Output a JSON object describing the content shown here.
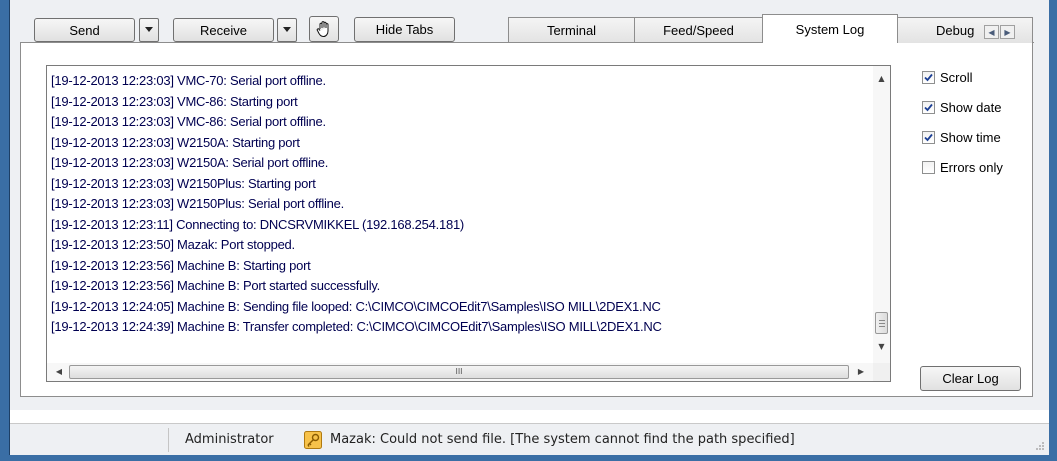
{
  "toolbar": {
    "send_label": "Send",
    "receive_label": "Receive",
    "hide_tabs_label": "Hide Tabs"
  },
  "tabs": [
    {
      "label": "Terminal",
      "active": false
    },
    {
      "label": "Feed/Speed",
      "active": false
    },
    {
      "label": "System Log",
      "active": true
    },
    {
      "label": "Debug",
      "active": false
    }
  ],
  "log": {
    "lines": [
      "[19-12-2013 12:23:03] VMC-70: Serial port offline.",
      "[19-12-2013 12:23:03] VMC-86: Starting port",
      "[19-12-2013 12:23:03] VMC-86: Serial port offline.",
      "[19-12-2013 12:23:03] W2150A: Starting port",
      "[19-12-2013 12:23:03] W2150A: Serial port offline.",
      "[19-12-2013 12:23:03] W2150Plus: Starting port",
      "[19-12-2013 12:23:03] W2150Plus: Serial port offline.",
      "[19-12-2013 12:23:11] Connecting to: DNCSRVMIKKEL (192.168.254.181)",
      "[19-12-2013 12:23:50] Mazak: Port stopped.",
      "[19-12-2013 12:23:56] Machine B: Starting port",
      "[19-12-2013 12:23:56] Machine B: Port started successfully.",
      "[19-12-2013 12:24:05] Machine B: Sending file looped: C:\\CIMCO\\CIMCOEdit7\\Samples\\ISO MILL\\2DEX1.NC",
      "[19-12-2013 12:24:39] Machine B: Transfer completed: C:\\CIMCO\\CIMCOEdit7\\Samples\\ISO MILL\\2DEX1.NC"
    ],
    "hscroll_grip": "III"
  },
  "options": {
    "scroll": {
      "label": "Scroll",
      "checked": true
    },
    "show_date": {
      "label": "Show date",
      "checked": true
    },
    "show_time": {
      "label": "Show time",
      "checked": true
    },
    "errors_only": {
      "label": "Errors only",
      "checked": false
    }
  },
  "clear_log_label": "Clear Log",
  "statusbar": {
    "user": "Administrator",
    "message": "Mazak: Could not send file. [The system cannot find the path specified]"
  },
  "colors": {
    "frame": "#3a6ea5",
    "panel": "#eef0f3",
    "log_text": "#000050"
  }
}
